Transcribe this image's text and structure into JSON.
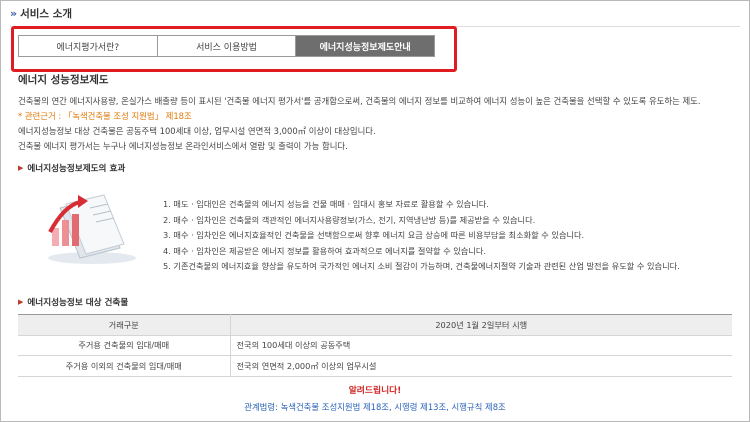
{
  "header": {
    "title": "서비스 소개"
  },
  "tabs": [
    {
      "label": "에너지평가서란?",
      "active": false
    },
    {
      "label": "서비스 이용방법",
      "active": false
    },
    {
      "label": "에너지성능정보제도안내",
      "active": true
    }
  ],
  "section": {
    "title": "에너지 성능정보제도",
    "paragraphs": [
      "건축물의 연간 에너지사용량, 온실가스 배출량 등이 표시된 '건축물 에너지 평가서'를 공개함으로써, 건축물의 에너지 정보를 비교하여 에너지 성능이 높은 건축물을 선택할 수 있도록 유도하는 제도.",
      "에너지성능정보 대상 건축물은 공동주택 100세대 이상, 업무시설 연면적 3,000㎡ 이상이 대상입니다.",
      "건축물 에너지 평가서는 누구나 에너지성능정보 온라인서비스에서 열람 및 출력이 가능 합니다."
    ],
    "law_prefix": "* 관련근거 : ",
    "law_name": "「녹색건축물 조성 지원법」",
    "law_article": " 제18조"
  },
  "effects": {
    "title": "에너지성능정보제도의 효과",
    "items": [
      "1. 매도 · 임대인은 건축물의 에너지 성능을 건물 매매 · 임대시 홍보 자료로 활용할 수 있습니다.",
      "2. 매수 · 임차인은 건축물의 객관적인 에너지사용량정보(가스, 전기, 지역냉난방 등)를 제공받을 수 있습니다.",
      "3. 매수 · 임차인은 에너지효율적인 건축물을 선택함으로써 향후 에너지 요금 상승에 따른 비용부담을 최소화할 수 있습니다.",
      "4. 매수 · 임차인은 제공받은 에너지 정보를 활용하여 효과적으로 에너지를 절약할 수 있습니다.",
      "5. 기존건축물의 에너지효율 향상을 유도하여 국가적인 에너지 소비 절감이 가능하며, 건축물에너지절약 기술과 관련된 산업 발전을 유도할 수 있습니다."
    ]
  },
  "targets": {
    "title": "에너지성능정보 대상 건축물",
    "headers": [
      "거래구분",
      "2020년 1월 2일부터 시행"
    ],
    "rows": [
      [
        "주거용 건축물의 임대/매매",
        "전국의 100세대 이상의 공동주택"
      ],
      [
        "주거용 이외의 건축물의 임대/매매",
        "전국의 연면적 2,000㎡ 이상의 업무시설"
      ]
    ]
  },
  "notice": {
    "title": "알려드립니다!",
    "related": "관계법령: 녹색건축물 조성지원법 제18조, 시행령 제13조, 시행규칙 제8조"
  },
  "colors": {
    "highlight": "#e11b22",
    "active_tab": "#6e6e6e",
    "notice": "#d02323",
    "link": "#2a63b8"
  }
}
